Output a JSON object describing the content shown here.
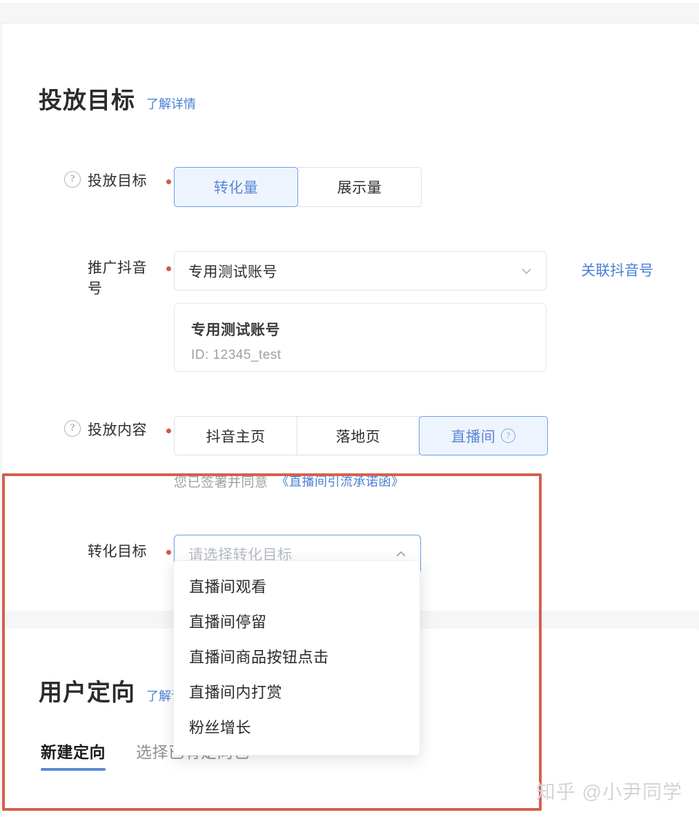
{
  "delivery_section": {
    "title": "投放目标",
    "detail_link": "了解详情",
    "goal_row": {
      "label": "投放目标",
      "options": [
        "转化量",
        "展示量"
      ],
      "selected": "转化量"
    },
    "account_row": {
      "label": "推广抖音号",
      "select_value": "专用测试账号",
      "link": "关联抖音号",
      "info_card": {
        "name": "专用测试账号",
        "id": "ID: 12345_test"
      }
    },
    "content_row": {
      "label": "投放内容",
      "options": [
        "抖音主页",
        "落地页",
        "直播间"
      ],
      "selected": "直播间",
      "note_text": "您已签署并同意",
      "note_link": "《直播间引流承诺函》"
    },
    "conversion_row": {
      "label": "转化目标",
      "placeholder": "请选择转化目标",
      "value": "",
      "dropdown_options": [
        "直播间观看",
        "直播间停留",
        "直播间商品按钮点击",
        "直播间内打赏",
        "粉丝增长"
      ]
    }
  },
  "targeting_section": {
    "title": "用户定向",
    "detail_link": "了解详情",
    "tabs": [
      {
        "label": "新建定向",
        "active": true
      },
      {
        "label": "选择已有定向包",
        "active": false
      }
    ]
  },
  "watermark": "知乎 @小尹同学",
  "colors": {
    "accent": "#5b86d8",
    "link": "#4a7fd4",
    "required": "#d0584f",
    "annotation": "#d4604f"
  }
}
